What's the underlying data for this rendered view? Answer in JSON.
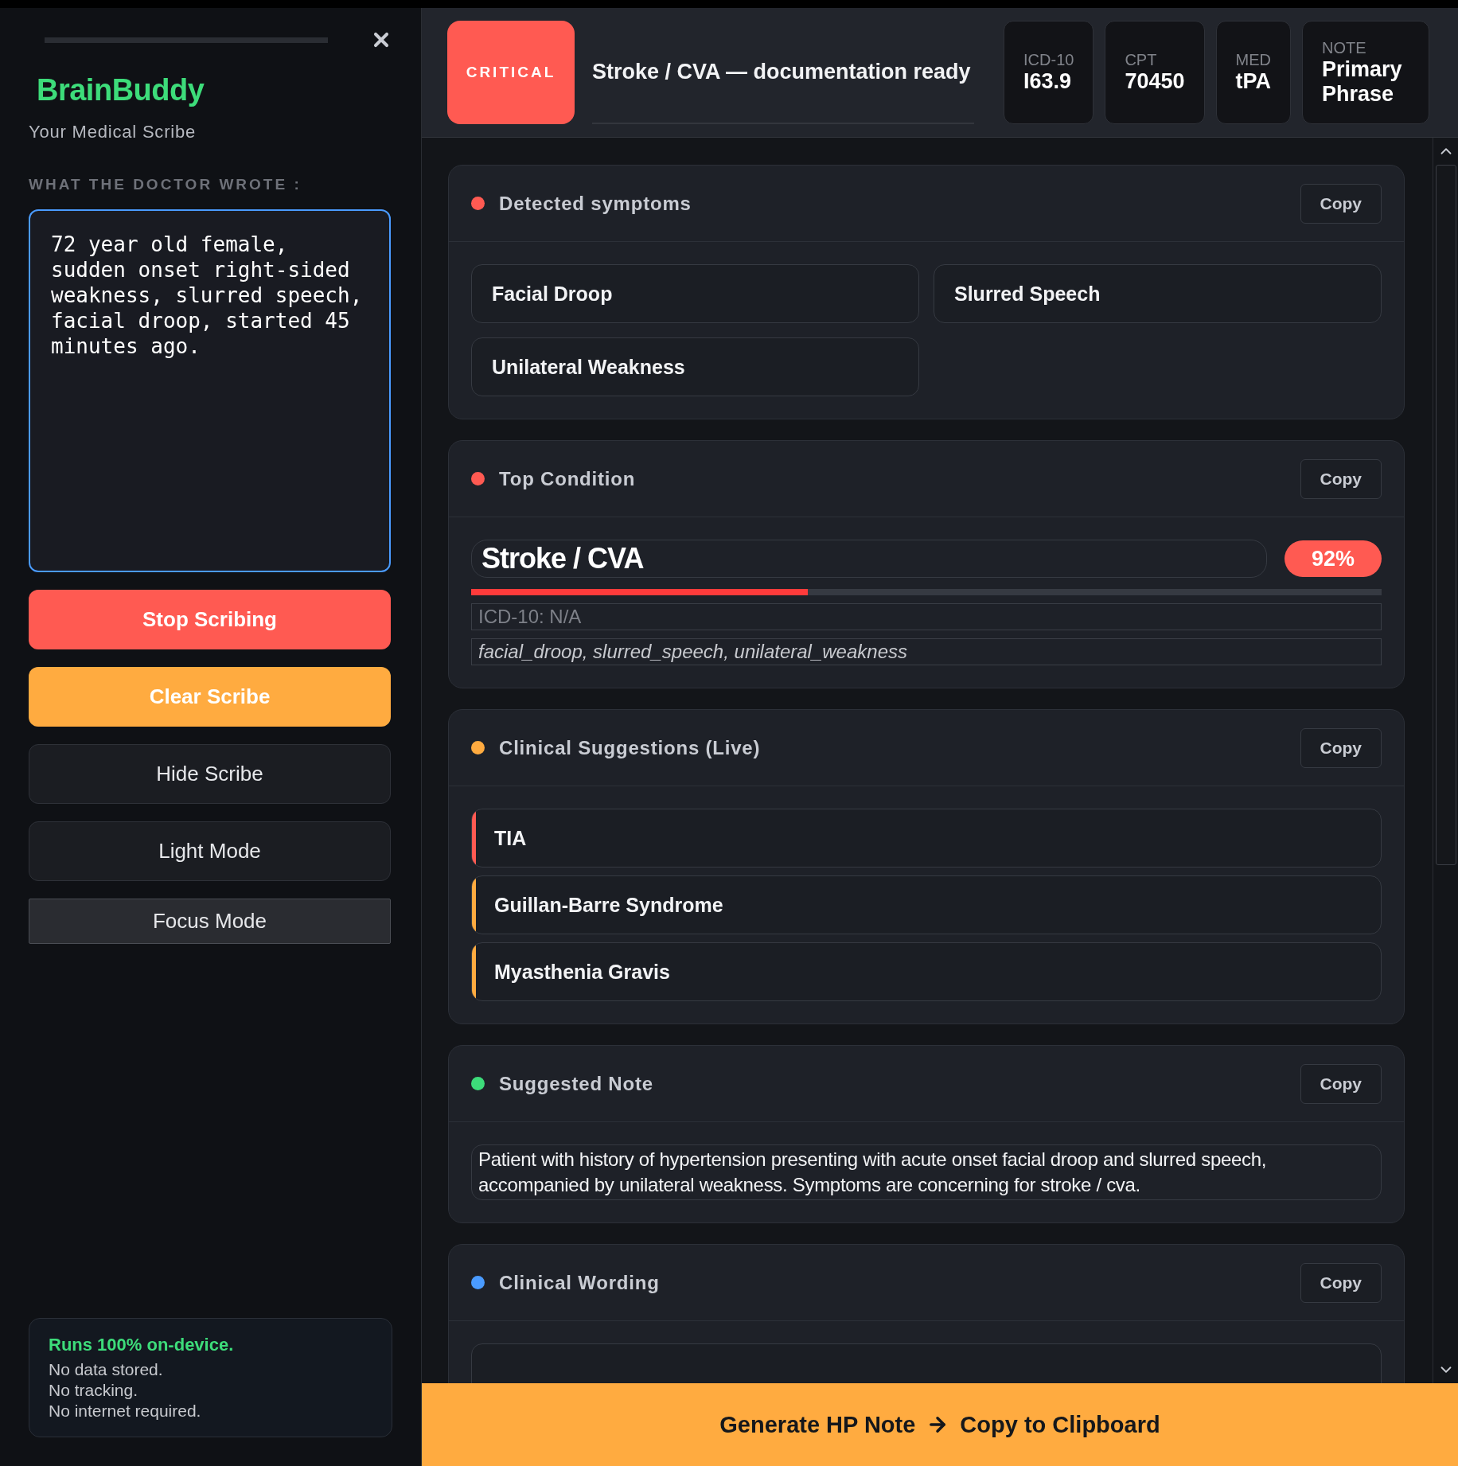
{
  "sidebar": {
    "brand": "BrainBuddy",
    "subtitle": "Your Medical Scribe",
    "input_label": "WHAT THE DOCTOR WROTE :",
    "input_value": "72 year old female, sudden onset right-sided weakness, slurred speech, facial droop, started 45 minutes ago.",
    "buttons": [
      {
        "label": "Stop Scribing",
        "kind": "danger"
      },
      {
        "label": "Clear Scribe",
        "kind": "warning"
      },
      {
        "label": "Hide Scribe",
        "kind": "plain"
      },
      {
        "label": "Light Mode",
        "kind": "plain"
      },
      {
        "label": "Focus Mode",
        "kind": "flat"
      }
    ],
    "privacy": {
      "headline": "Runs 100% on-device.",
      "lines": [
        "No data stored.",
        "No tracking.",
        "No internet required."
      ]
    }
  },
  "header": {
    "severity": "CRITICAL",
    "title": "Stroke / CVA — documentation ready",
    "codes": [
      {
        "label": "ICD-10",
        "value": "I63.9"
      },
      {
        "label": "CPT",
        "value": "70450"
      },
      {
        "label": "MED",
        "value": "tPA"
      },
      {
        "label": "NOTE",
        "value": "Primary Phrase"
      }
    ]
  },
  "sections": [
    {
      "kind": "chips",
      "title": "Detected symptoms",
      "color": "#ff5a52",
      "copy": "Copy",
      "items": [
        "Facial Droop",
        "Slurred Speech",
        "Unilateral Weakness"
      ]
    },
    {
      "kind": "condition",
      "title": "Top Condition",
      "color": "#ff5a52",
      "copy": "Copy",
      "name": "Stroke / CVA",
      "score": "92%",
      "level": 0.37,
      "code": "ICD-10: N/A",
      "keywords": "facial_droop, slurred_speech, unilateral_weakness"
    },
    {
      "kind": "suggestions",
      "title": "Clinical Suggestions (Live)",
      "color": "#ffab40",
      "copy": "Copy",
      "items": [
        {
          "label": "TIA",
          "color": "#ff5a52"
        },
        {
          "label": "Guillan-Barre Syndrome",
          "color": "#ffab40"
        },
        {
          "label": "Myasthenia Gravis",
          "color": "#ffab40"
        }
      ]
    },
    {
      "kind": "note",
      "title": "Suggested Note",
      "color": "#3ddc7a",
      "copy": "Copy",
      "text": "Patient with history of hypertension presenting with acute onset facial droop and slurred speech, accompanied by unilateral weakness. Symptoms are concerning for stroke / cva."
    },
    {
      "kind": "wording",
      "title": "Clinical Wording",
      "color": "#4a9bff",
      "copy": "Copy"
    }
  ],
  "cta": {
    "left": "Generate HP Note",
    "right": "Copy to Clipboard"
  }
}
